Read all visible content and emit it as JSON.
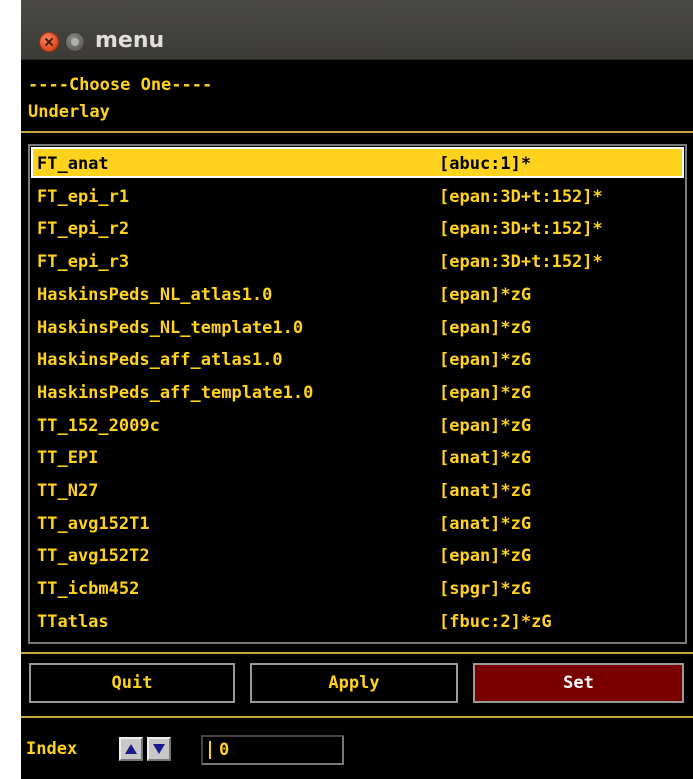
{
  "window": {
    "title": "menu"
  },
  "header": {
    "line1": "----Choose One----",
    "line2": "Underlay"
  },
  "datasets": [
    {
      "name": "FT_anat",
      "info": "[abuc:1]*",
      "selected": true
    },
    {
      "name": "FT_epi_r1",
      "info": "[epan:3D+t:152]*"
    },
    {
      "name": "FT_epi_r2",
      "info": "[epan:3D+t:152]*"
    },
    {
      "name": "FT_epi_r3",
      "info": "[epan:3D+t:152]*"
    },
    {
      "name": "HaskinsPeds_NL_atlas1.0",
      "info": "[epan]*zG"
    },
    {
      "name": "HaskinsPeds_NL_template1.0",
      "info": "[epan]*zG"
    },
    {
      "name": "HaskinsPeds_aff_atlas1.0",
      "info": "[epan]*zG"
    },
    {
      "name": "HaskinsPeds_aff_template1.0",
      "info": "[epan]*zG"
    },
    {
      "name": "TT_152_2009c",
      "info": "[epan]*zG"
    },
    {
      "name": "TT_EPI",
      "info": "[anat]*zG"
    },
    {
      "name": "TT_N27",
      "info": "[anat]*zG"
    },
    {
      "name": "TT_avg152T1",
      "info": "[anat]*zG"
    },
    {
      "name": "TT_avg152T2",
      "info": "[epan]*zG"
    },
    {
      "name": "TT_icbm452",
      "info": "[spgr]*zG"
    },
    {
      "name": "TTatlas",
      "info": "[fbuc:2]*zG"
    }
  ],
  "buttons": {
    "quit": "Quit",
    "apply": "Apply",
    "set": "Set"
  },
  "index": {
    "label": "Index",
    "value": "0",
    "up_icon": "arrow-up-icon",
    "down_icon": "arrow-down-icon"
  },
  "colors": {
    "text": "#ffd21e",
    "background": "#000000",
    "selected_bg": "#ffd21e",
    "set_button_bg": "#7a0000"
  }
}
